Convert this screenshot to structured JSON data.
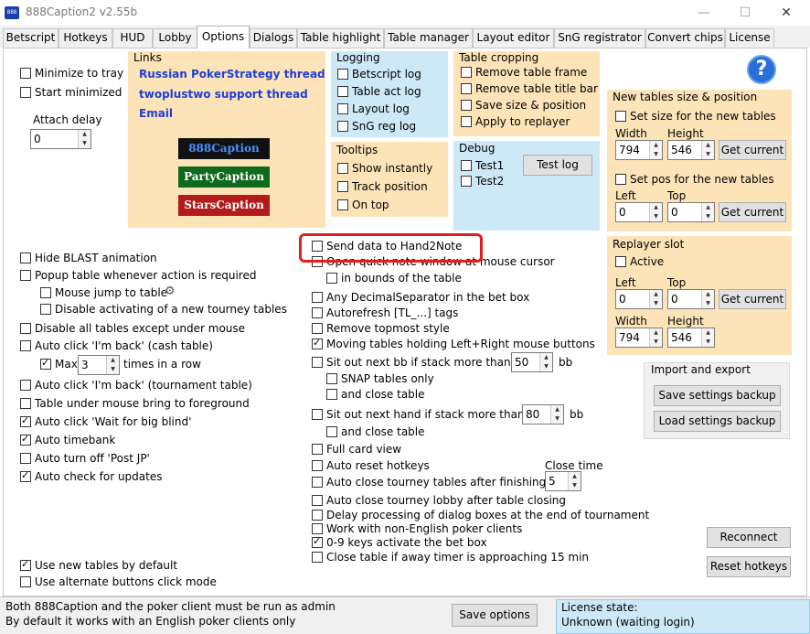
{
  "window": {
    "title": "888Caption2 v2.55b",
    "icon_text": "888",
    "controls": [
      "—",
      "☐",
      "✕"
    ]
  },
  "tabs": [
    "Betscript",
    "Hotkeys",
    "HUD",
    "Lobby",
    "Options",
    "Dialogs",
    "Table highlight",
    "Table manager",
    "Layout editor",
    "SnG registrator",
    "Convert chips",
    "License"
  ],
  "active_tab": "Options",
  "left_top": {
    "minimize_to_tray": "Minimize to tray",
    "start_minimized": "Start minimized",
    "attach_delay_label": "Attach delay",
    "attach_delay_value": "0"
  },
  "links": {
    "title": "Links",
    "items": [
      "Russian PokerStrategy thread",
      "twoplustwo support thread",
      "Email"
    ],
    "buttons": [
      {
        "label": "888Caption",
        "bg": "#111111",
        "fg": "#4a90ff"
      },
      {
        "label": "PartyCaption",
        "bg": "#0f6a1e",
        "fg": "#ffffff"
      },
      {
        "label": "StarsCaption",
        "bg": "#b31b1b",
        "fg": "#ffffff"
      }
    ]
  },
  "logging": {
    "title": "Logging",
    "items": [
      "Betscript log",
      "Table act log",
      "Layout log",
      "SnG reg log"
    ]
  },
  "tooltips": {
    "title": "Tooltips",
    "items": [
      "Show instantly",
      "Track position",
      "On top"
    ]
  },
  "table_cropping": {
    "title": "Table cropping",
    "items": [
      "Remove table frame",
      "Remove table title bar",
      "Save size & position",
      "Apply to replayer"
    ]
  },
  "debug": {
    "title": "Debug",
    "items": [
      "Test1",
      "Test2"
    ],
    "test_log_button": "Test log"
  },
  "new_tables": {
    "title": "New tables size & position",
    "set_size": "Set size for the new tables",
    "width_label": "Width",
    "height_label": "Height",
    "width_value": "794",
    "height_value": "546",
    "get_current": "Get current",
    "set_pos": "Set pos for the new tables",
    "left_label": "Left",
    "top_label": "Top",
    "left_value": "0",
    "top_value": "0"
  },
  "replayer_slot": {
    "title": "Replayer slot",
    "active": "Active",
    "left_label": "Left",
    "top_label": "Top",
    "left_value": "0",
    "top_value": "0",
    "get_current": "Get current",
    "width_label": "Width",
    "height_label": "Height",
    "width_value": "794",
    "height_value": "546"
  },
  "import_export": {
    "title": "Import and export",
    "save_backup": "Save settings backup",
    "load_backup": "Load settings backup"
  },
  "left_options": [
    {
      "label": "Hide BLAST animation",
      "checked": false
    },
    {
      "label": "Popup table whenever action is required",
      "checked": false
    },
    {
      "label": "Mouse jump to table",
      "checked": false
    },
    {
      "label": "Disable activating of a new tourney tables",
      "checked": false
    },
    {
      "label": "Disable all tables except under mouse",
      "checked": false
    },
    {
      "label": "Auto click 'I'm back' (cash table)",
      "checked": false
    },
    {
      "label": "Max",
      "checked": true
    },
    {
      "label": "times in a row",
      "checked": false
    },
    {
      "label": "Auto click 'I'm back' (tournament table)",
      "checked": false
    },
    {
      "label": "Table under mouse bring to foreground",
      "checked": false
    },
    {
      "label": "Auto click 'Wait for big blind'",
      "checked": true
    },
    {
      "label": "Auto timebank",
      "checked": true
    },
    {
      "label": "Auto turn off 'Post JP'",
      "checked": false
    },
    {
      "label": "Auto check for updates",
      "checked": true
    }
  ],
  "max_value": "3",
  "left_bottom": [
    {
      "label": "Use new tables by default",
      "checked": true
    },
    {
      "label": "Use alternate buttons click mode",
      "checked": false
    }
  ],
  "middle_options": [
    {
      "label": "Send data to Hand2Note",
      "checked": false
    },
    {
      "label": "Open quick note window at mouse cursor",
      "checked": false
    },
    {
      "label": "in bounds of the table",
      "checked": false
    },
    {
      "label": "Any DecimalSeparator in the bet box",
      "checked": false
    },
    {
      "label": "Autorefresh [TL_...] tags",
      "checked": false
    },
    {
      "label": "Remove topmost style",
      "checked": false
    },
    {
      "label": "Moving tables holding Left+Right mouse buttons",
      "checked": true
    },
    {
      "label": "Sit out next bb if stack more than",
      "checked": false
    },
    {
      "label": "SNAP tables only",
      "checked": false
    },
    {
      "label": "and close table",
      "checked": false
    },
    {
      "label": "Sit out next hand if stack more than",
      "checked": false
    },
    {
      "label": "and close table",
      "checked": false
    },
    {
      "label": "Full card view",
      "checked": false
    },
    {
      "label": "Auto reset hotkeys",
      "checked": false
    },
    {
      "label": "Auto close tourney tables after finishing",
      "checked": false
    },
    {
      "label": "Auto close tourney lobby after table closing",
      "checked": false
    },
    {
      "label": "Delay processing of dialog boxes at the end of tournament",
      "checked": false
    },
    {
      "label": "Work with non-English poker clients",
      "checked": false
    },
    {
      "label": "0-9 keys activate the bet box",
      "checked": true
    },
    {
      "label": "Close table if away timer is approaching 15 min",
      "checked": false
    }
  ],
  "sitout_bb_value": "50",
  "sitout_hand_value": "80",
  "bb_unit": "bb",
  "close_time_label": "Close time",
  "close_time_value": "5",
  "right_buttons": {
    "reconnect": "Reconnect",
    "reset_hotkeys": "Reset hotkeys"
  },
  "status": {
    "line1": "Both 888Caption and the poker client must be run as admin",
    "line2": "By default it works with an English poker clients only",
    "save_options": "Save options",
    "license_label": "License state:",
    "license_value": "Unknown (waiting login)"
  }
}
